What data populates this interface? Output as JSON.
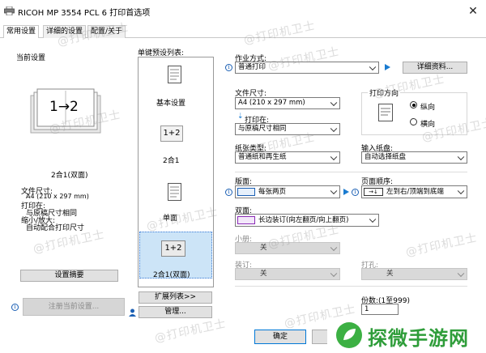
{
  "window": {
    "title": "RICOH MP 3554 PCL 6 打印首选项",
    "close_icon": "close-icon"
  },
  "tabs": [
    {
      "label": "常用设置",
      "active": true
    },
    {
      "label": "详细的设置",
      "active": false
    },
    {
      "label": "配置/关于",
      "active": false
    }
  ],
  "current": {
    "heading": "当前设置",
    "preview_text": "1→2",
    "caption": "2合1(双面)",
    "details": [
      "文件尺寸:",
      "A4 (210 x 297 mm)",
      "打印在:",
      "与原稿尺寸相同",
      "缩小/放大:",
      "自动配合打印尺寸"
    ],
    "summary_button": "设置摘要",
    "register_button": "注册当前设置..."
  },
  "presets": {
    "heading": "单键预设列表:",
    "items": [
      {
        "label": "基本设置",
        "glyph": ""
      },
      {
        "label": "2合1",
        "glyph": "1+2"
      },
      {
        "label": "单面",
        "glyph": ""
      },
      {
        "label": "2合1(双面)",
        "glyph": "1+2"
      }
    ],
    "expand_button": "扩展列表>>",
    "manage_button": "管理..."
  },
  "settings": {
    "job_type_label": "作业方式:",
    "job_type_value": "普通打印",
    "details_button": "详细资料...",
    "doc_size_label": "文件尺寸:",
    "doc_size_value": "A4 (210 x 297 mm)",
    "print_on_label": "打印在:",
    "print_on_value": "与原稿尺寸相同",
    "orientation_label": "打印方向",
    "orientation_portrait": "纵向",
    "orientation_landscape": "横向",
    "paper_type_label": "纸张类型:",
    "paper_type_value": "普通纸和再生纸",
    "input_tray_label": "输入纸盘:",
    "input_tray_value": "自动选择纸盘",
    "layout_label": "版面:",
    "layout_value": "每张两页",
    "page_order_label": "页面顺序:",
    "page_order_value": "左到右/顶端到底端",
    "duplex_label": "双面:",
    "duplex_value": "长边装订(向左翻页/向上翻页)",
    "booklet_label": "小册:",
    "booklet_value": "关",
    "staple_label": "装订:",
    "staple_value": "关",
    "punch_label": "打孔:",
    "punch_value": "关",
    "copies_label": "份数:(1至999)",
    "copies_value": "1"
  },
  "footer": {
    "ok_button": "确定"
  },
  "watermark_text": "@打印机卫士",
  "brand_logo": {
    "text": "探微手游网"
  },
  "colors": {
    "accent": "#1a5fb4",
    "selected_bg": "#cce4f7",
    "brand_green": "#3cb043"
  }
}
